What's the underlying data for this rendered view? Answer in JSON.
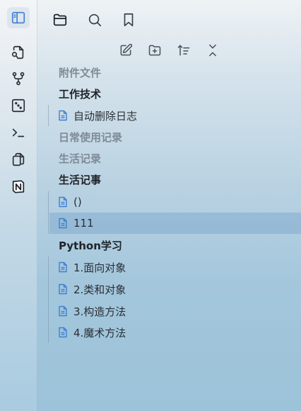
{
  "ribbon": {
    "icons": [
      "sidebar-toggle-icon",
      "open-quick-switcher-icon",
      "graph-view-icon",
      "random-note-icon",
      "terminal-icon",
      "copy-icon",
      "notion-icon"
    ]
  },
  "topbar": {
    "icons": [
      "files-icon",
      "search-icon",
      "bookmark-icon"
    ]
  },
  "file_actions": {
    "icons": [
      "new-note-icon",
      "new-folder-icon",
      "sort-icon",
      "collapse-all-icon"
    ]
  },
  "tree": {
    "f1": "附件文件",
    "f2": "工作技术",
    "f2_files": [
      "自动删除日志"
    ],
    "f3": "日常使用记录",
    "f4": "生活记录",
    "f5": "生活记事",
    "f5_files": [
      "()",
      "111"
    ],
    "f6": "Python学习",
    "f6_files": [
      "1.面向对象",
      "2.类和对象",
      "3.构造方法",
      "4.魔术方法"
    ]
  },
  "colors": {
    "accent": "#3f7fd1",
    "text": "#1f2328",
    "muted": "#7f8a95",
    "selected_bg": "#a9c9e3"
  }
}
